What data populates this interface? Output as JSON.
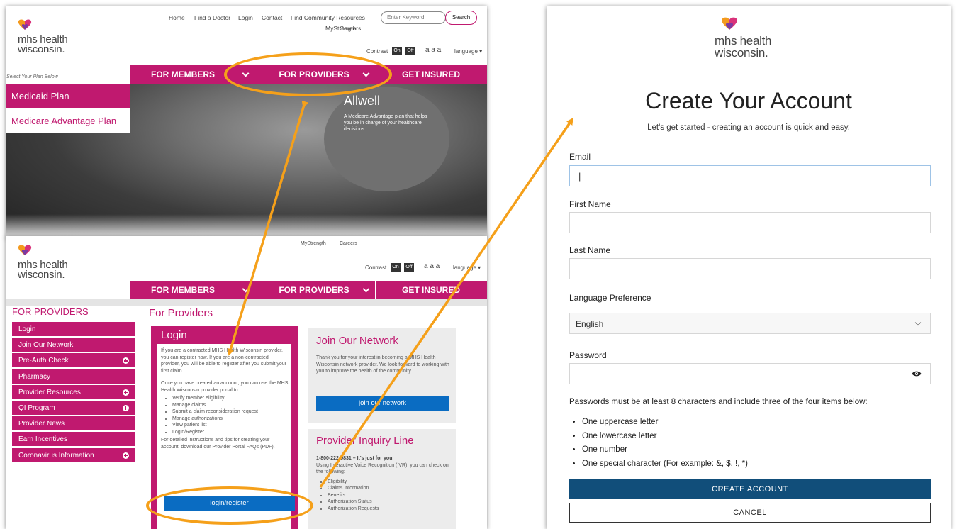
{
  "brand": {
    "logo_line1": "mhs health",
    "logo_line2": "wisconsin.",
    "accent": "#c0196f",
    "orange": "#f5a01a",
    "navy": "#114e7a",
    "blue": "#0a6cc2"
  },
  "home_page": {
    "top_links": [
      "Home",
      "Find a Doctor",
      "Login",
      "Contact",
      "Find Community Resources"
    ],
    "top_links_row2": [
      "MyStrength",
      "Careers"
    ],
    "search_placeholder": "Enter Keyword",
    "search_button": "Search",
    "contrast_label": "Contrast",
    "contrast_on": "On",
    "contrast_off": "Off",
    "text_size": "a a a",
    "language": "language",
    "select_plan_label": "Select Your Plan Below",
    "nav": {
      "members": "FOR MEMBERS",
      "providers": "FOR PROVIDERS",
      "insured": "GET INSURED"
    },
    "plans": [
      "Medicaid Plan",
      "Medicare Advantage Plan"
    ],
    "hero_title": "Allwell",
    "hero_text": "A Medicare Advantage plan that helps you be in charge of your healthcare decisions."
  },
  "provider_page": {
    "top_links_row2": [
      "MyStrength",
      "Careers"
    ],
    "contrast_label": "Contrast",
    "contrast_on": "On",
    "contrast_off": "Off",
    "text_size": "a a a",
    "language": "language",
    "nav": {
      "members": "FOR MEMBERS",
      "providers": "FOR PROVIDERS",
      "insured": "GET INSURED"
    },
    "sidebar_title": "FOR PROVIDERS",
    "sidebar": [
      {
        "label": "Login",
        "plus": false
      },
      {
        "label": "Join Our Network",
        "plus": false
      },
      {
        "label": "Pre-Auth Check",
        "plus": true
      },
      {
        "label": "Pharmacy",
        "plus": false
      },
      {
        "label": "Provider Resources",
        "plus": true
      },
      {
        "label": "QI Program",
        "plus": true
      },
      {
        "label": "Provider News",
        "plus": false
      },
      {
        "label": "Earn Incentives",
        "plus": false
      },
      {
        "label": "Coronavirus Information",
        "plus": true
      }
    ],
    "heading": "For Providers",
    "login_card": {
      "title": "Login",
      "para1": "If you are a contracted MHS Health Wisconsin provider, you can register now. If you are a non-contracted provider, you will be able to register after you submit your first claim.",
      "para2": "Once you have created an account, you can use the MHS Health Wisconsin provider portal to:",
      "items": [
        "Verify member eligibility",
        "Manage claims",
        "Submit a claim reconsideration request",
        "Manage authorizations",
        "View patient list",
        "Login/Register"
      ],
      "para3": "For detailed instructions and tips for creating your account, download our Provider Portal FAQs (PDF).",
      "button": "login/register"
    },
    "join_card": {
      "title": "Join Our Network",
      "text": "Thank you for your interest in becoming a MHS Health Wisconsin network provider. We look forward to working with you to improve the health of the community.",
      "button": "join our network"
    },
    "inquiry_card": {
      "title": "Provider Inquiry Line",
      "phone_line": "1-800-222-9831 – It's just for you.",
      "text": "Using Interactive Voice Recognition (IVR), you can check on the following:",
      "items": [
        "Eligibility",
        "Claims Information",
        "Benefits",
        "Authorization Status",
        "Authorization Requests"
      ]
    }
  },
  "create_account": {
    "title": "Create Your Account",
    "subtitle": "Let's get started - creating an account is quick and easy.",
    "fields": {
      "email_label": "Email",
      "email_value": "|",
      "first_name_label": "First Name",
      "last_name_label": "Last Name",
      "language_label": "Language Preference",
      "language_value": "English",
      "password_label": "Password"
    },
    "password_rules_heading": "Passwords must be at least 8 characters and include three of the four items below:",
    "password_rules": [
      "One uppercase letter",
      "One lowercase letter",
      "One number",
      "One special character (For example: &, $, !, *)"
    ],
    "create_button": "CREATE ACCOUNT",
    "cancel_button": "CANCEL"
  }
}
